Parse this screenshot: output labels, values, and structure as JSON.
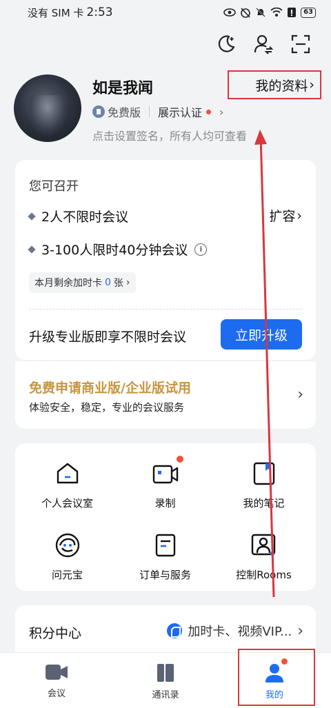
{
  "status_bar": {
    "carrier": "没有 SIM 卡",
    "time": "2:53",
    "battery": "63"
  },
  "top_actions": {
    "dark_mode": "moon-icon",
    "account_switch": "person-switch-icon",
    "scan": "scan-icon"
  },
  "profile": {
    "name": "如是我闻",
    "my_info_label": "我的资料",
    "my_info_chevron": "›",
    "edition_label": "免费版",
    "verify_label": "展示认证",
    "verify_chevron": "›",
    "signature_placeholder": "点击设置签名，所有人均可查看"
  },
  "meeting_card": {
    "heading": "您可召开",
    "plan_1": "2人不限时会议",
    "plan_2": "3-100人限时40分钟会议",
    "expand_label": "扩容",
    "expand_chevron": "›",
    "addon_prefix": "本月剩余加时卡",
    "addon_count": "0",
    "addon_suffix": "张",
    "addon_chevron": "›",
    "upgrade_text": "升级专业版即享不限时会议",
    "upgrade_button": "立即升级"
  },
  "trial_card": {
    "title": "免费申请商业版/企业版试用",
    "description": "体验安全，稳定，专业的会议服务",
    "chevron": "›"
  },
  "feature_grid": [
    {
      "label": "个人会议室",
      "icon": "home-icon"
    },
    {
      "label": "录制",
      "icon": "video-record-icon"
    },
    {
      "label": "我的笔记",
      "icon": "notes-icon"
    },
    {
      "label": "问元宝",
      "icon": "yuanbao-icon"
    },
    {
      "label": "订单与服务",
      "icon": "order-icon"
    },
    {
      "label": "控制Rooms",
      "icon": "rooms-icon"
    }
  ],
  "points_card": {
    "title": "积分中心",
    "right_text": "加时卡、视频VIP...",
    "chevron": "›"
  },
  "tab_bar": [
    {
      "label": "会议",
      "icon": "meeting-tab-icon"
    },
    {
      "label": "通讯录",
      "icon": "contacts-tab-icon"
    },
    {
      "label": "我的",
      "icon": "profile-tab-icon"
    }
  ],
  "colors": {
    "accent": "#1d6cf0",
    "annotation": "#d9363e",
    "trial_gold": "#c6963f",
    "notification_dot": "#f2503c"
  }
}
